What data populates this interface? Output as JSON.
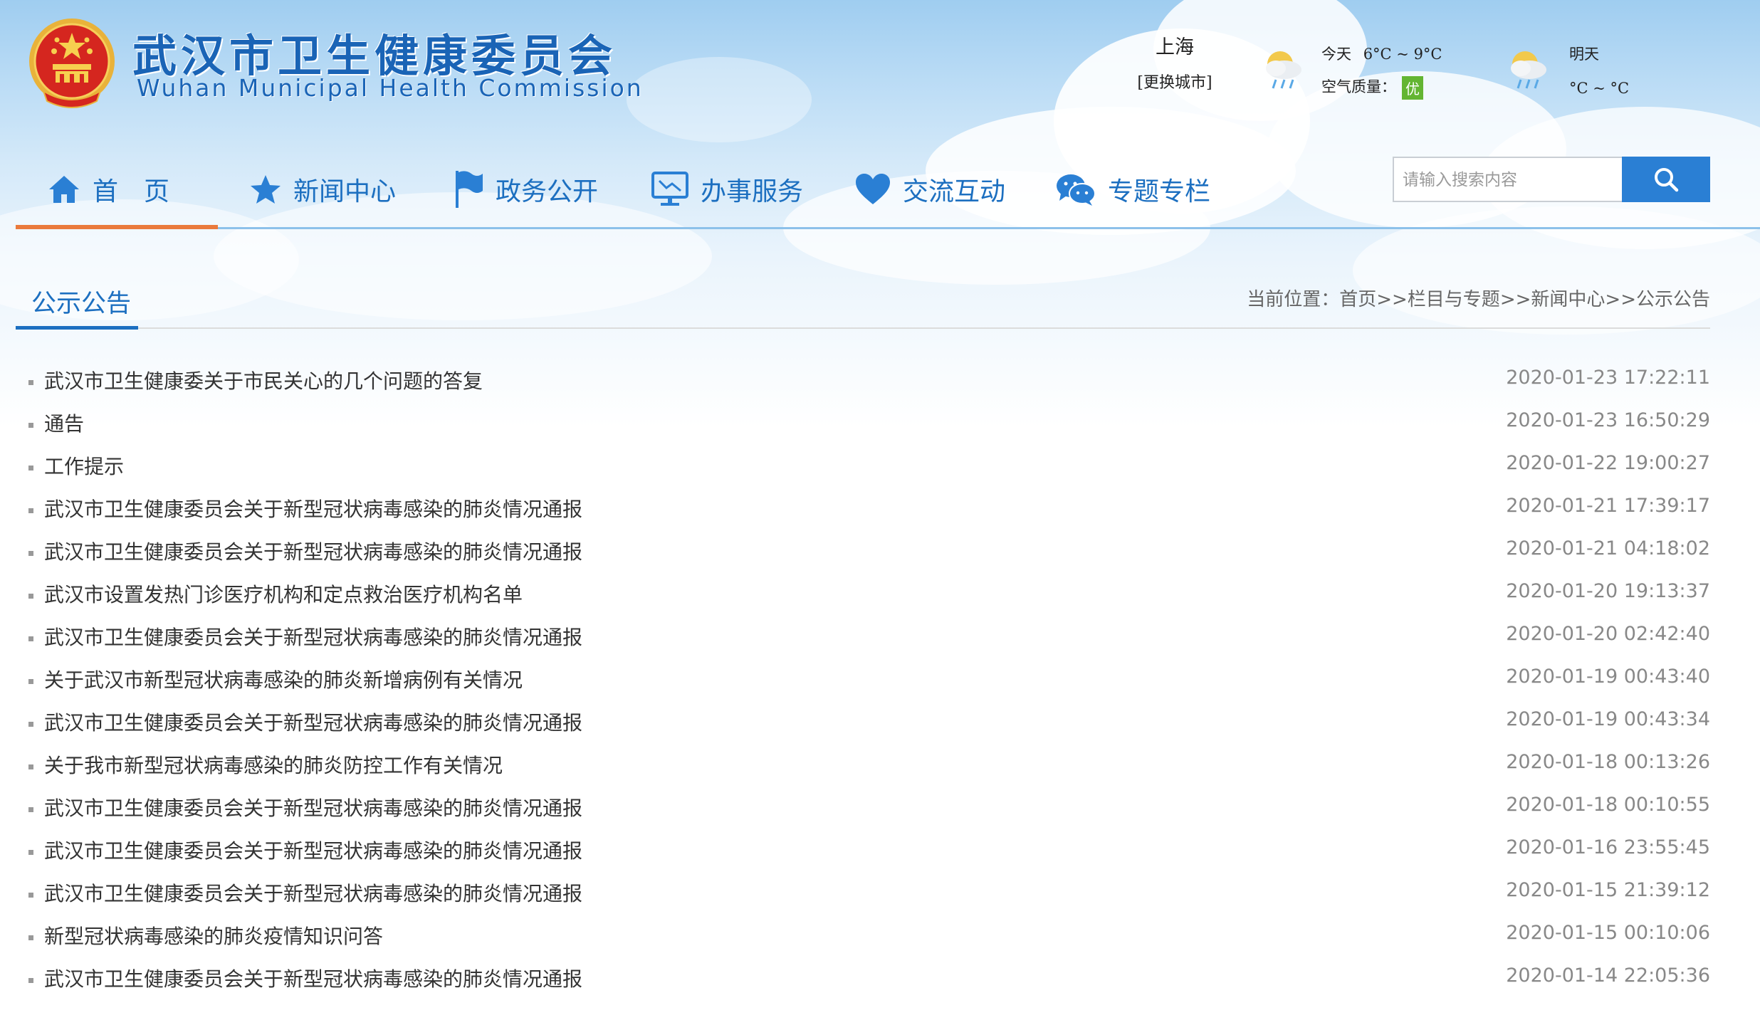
{
  "header": {
    "title_cn": "武汉市卫生健康委员会",
    "title_en": "Wuhan Municipal Health Commission"
  },
  "weather": {
    "city": "上海",
    "change_city": "[更换城市]",
    "today_label": "今天",
    "today_temp": "6°C ~ 9°C",
    "air_quality_label": "空气质量：",
    "air_quality_value": "优",
    "tomorrow_label": "明天",
    "tomorrow_temp": "°C ~ °C"
  },
  "nav": {
    "items": [
      {
        "label": "首　页",
        "icon": "home-icon"
      },
      {
        "label": "新闻中心",
        "icon": "star-icon"
      },
      {
        "label": "政务公开",
        "icon": "flag-icon"
      },
      {
        "label": "办事服务",
        "icon": "monitor-icon"
      },
      {
        "label": "交流互动",
        "icon": "heart-icon"
      },
      {
        "label": "专题专栏",
        "icon": "chat-icon"
      }
    ],
    "active_index": 0
  },
  "search": {
    "placeholder": "请输入搜索内容",
    "value": "",
    "button_icon": "search-icon"
  },
  "section": {
    "title": "公示公告"
  },
  "breadcrumb": {
    "prefix": "当前位置：",
    "items": [
      "首页",
      "栏目与专题",
      "新闻中心",
      "公示公告"
    ],
    "separator": ">>"
  },
  "list": [
    {
      "title": "武汉市卫生健康委关于市民关心的几个问题的答复",
      "date": "2020-01-23 17:22:11"
    },
    {
      "title": "通告",
      "date": "2020-01-23 16:50:29"
    },
    {
      "title": "工作提示",
      "date": "2020-01-22 19:00:27"
    },
    {
      "title": "武汉市卫生健康委员会关于新型冠状病毒感染的肺炎情况通报",
      "date": "2020-01-21 17:39:17"
    },
    {
      "title": "武汉市卫生健康委员会关于新型冠状病毒感染的肺炎情况通报",
      "date": "2020-01-21 04:18:02"
    },
    {
      "title": "武汉市设置发热门诊医疗机构和定点救治医疗机构名单",
      "date": "2020-01-20 19:13:37"
    },
    {
      "title": "武汉市卫生健康委员会关于新型冠状病毒感染的肺炎情况通报",
      "date": "2020-01-20 02:42:40"
    },
    {
      "title": "关于武汉市新型冠状病毒感染的肺炎新增病例有关情况",
      "date": "2020-01-19 00:43:40"
    },
    {
      "title": "武汉市卫生健康委员会关于新型冠状病毒感染的肺炎情况通报",
      "date": "2020-01-19 00:43:34"
    },
    {
      "title": "关于我市新型冠状病毒感染的肺炎防控工作有关情况",
      "date": "2020-01-18 00:13:26"
    },
    {
      "title": "武汉市卫生健康委员会关于新型冠状病毒感染的肺炎情况通报",
      "date": "2020-01-18 00:10:55"
    },
    {
      "title": "武汉市卫生健康委员会关于新型冠状病毒感染的肺炎情况通报",
      "date": "2020-01-16 23:55:45"
    },
    {
      "title": "武汉市卫生健康委员会关于新型冠状病毒感染的肺炎情况通报",
      "date": "2020-01-15 21:39:12"
    },
    {
      "title": "新型冠状病毒感染的肺炎疫情知识问答",
      "date": "2020-01-15 00:10:06"
    },
    {
      "title": "武汉市卫生健康委员会关于新型冠状病毒感染的肺炎情况通报",
      "date": "2020-01-14 22:05:36"
    }
  ],
  "colors": {
    "brand_blue": "#1c6fc0",
    "nav_active": "#ea7a3c",
    "air_quality_good": "#63b532",
    "search_button": "#2a7fd4"
  }
}
